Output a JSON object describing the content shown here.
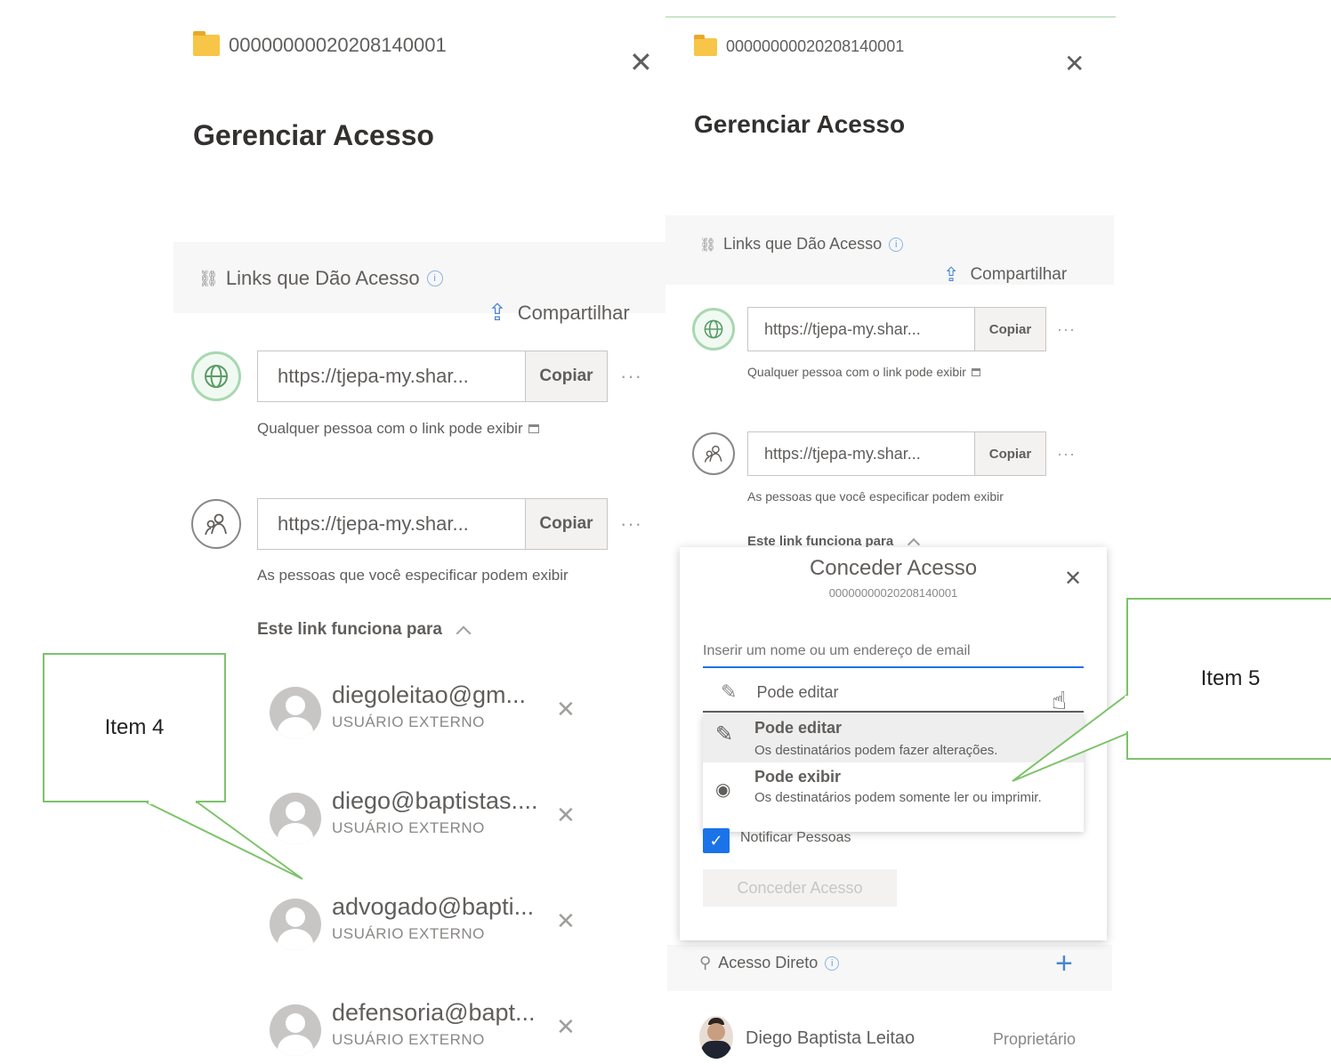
{
  "left": {
    "file_name": "00000000020208140001",
    "close_glyph": "✕",
    "title": "Gerenciar Acesso",
    "links_heading": "Links que Dão Acesso",
    "share_label": "Compartilhar",
    "links": [
      {
        "url": "https://tjepa-my.shar...",
        "copy_label": "Copiar",
        "more": "···",
        "description": "Qualquer pessoa com o link pode exibir",
        "icon": "globe-icon"
      },
      {
        "url": "https://tjepa-my.shar...",
        "copy_label": "Copiar",
        "more": "···",
        "description": "As pessoas que você especificar podem exibir",
        "icon": "people-icon"
      }
    ],
    "works_for_label": "Este link funciona para",
    "users": [
      {
        "email": "diegoleitao@gm...",
        "type": "USUÁRIO EXTERNO",
        "remove": "✕"
      },
      {
        "email": "diego@baptistas....",
        "type": "USUÁRIO EXTERNO",
        "remove": "✕"
      },
      {
        "email": "advogado@bapti...",
        "type": "USUÁRIO EXTERNO",
        "remove": "✕"
      },
      {
        "email": "defensoria@bapt...",
        "type": "USUÁRIO EXTERNO",
        "remove": "✕"
      }
    ]
  },
  "right": {
    "file_name": "00000000020208140001",
    "close_glyph": "✕",
    "title": "Gerenciar Acesso",
    "links_heading": "Links que Dão Acesso",
    "share_label": "Compartilhar",
    "links": [
      {
        "url": "https://tjepa-my.shar...",
        "copy_label": "Copiar",
        "more": "···",
        "description": "Qualquer pessoa com o link pode exibir",
        "icon": "globe-icon"
      },
      {
        "url": "https://tjepa-my.shar...",
        "copy_label": "Copiar",
        "more": "···",
        "description": "As pessoas que você especificar podem exibir",
        "icon": "people-icon"
      }
    ],
    "works_for_label": "Este link funciona para",
    "modal": {
      "title": "Conceder Acesso",
      "subtitle": "00000000020208140001",
      "close_glyph": "✕",
      "input_placeholder": "Inserir um nome ou um endereço de email",
      "dropdown_selected": "Pode editar",
      "options": [
        {
          "title": "Pode editar",
          "description": "Os destinatários podem fazer alterações.",
          "icon": "pencil-icon"
        },
        {
          "title": "Pode exibir",
          "description": "Os destinatários podem somente ler ou imprimir.",
          "icon": "eye-icon"
        }
      ],
      "notify_label": "Notificar Pessoas",
      "notify_checked": true,
      "grant_button": "Conceder Acesso"
    },
    "direct_access_label": "Acesso Direto",
    "add_glyph": "+",
    "owner_name": "Diego Baptista Leitao",
    "owner_role": "Proprietário"
  },
  "callouts": {
    "item4": "Item 4",
    "item5": "Item 5"
  },
  "colors": {
    "callout_border": "#7cc36a",
    "accent_blue": "#1a73e8",
    "globe_ring": "#a8d8b0",
    "folder": "#f7c548"
  }
}
